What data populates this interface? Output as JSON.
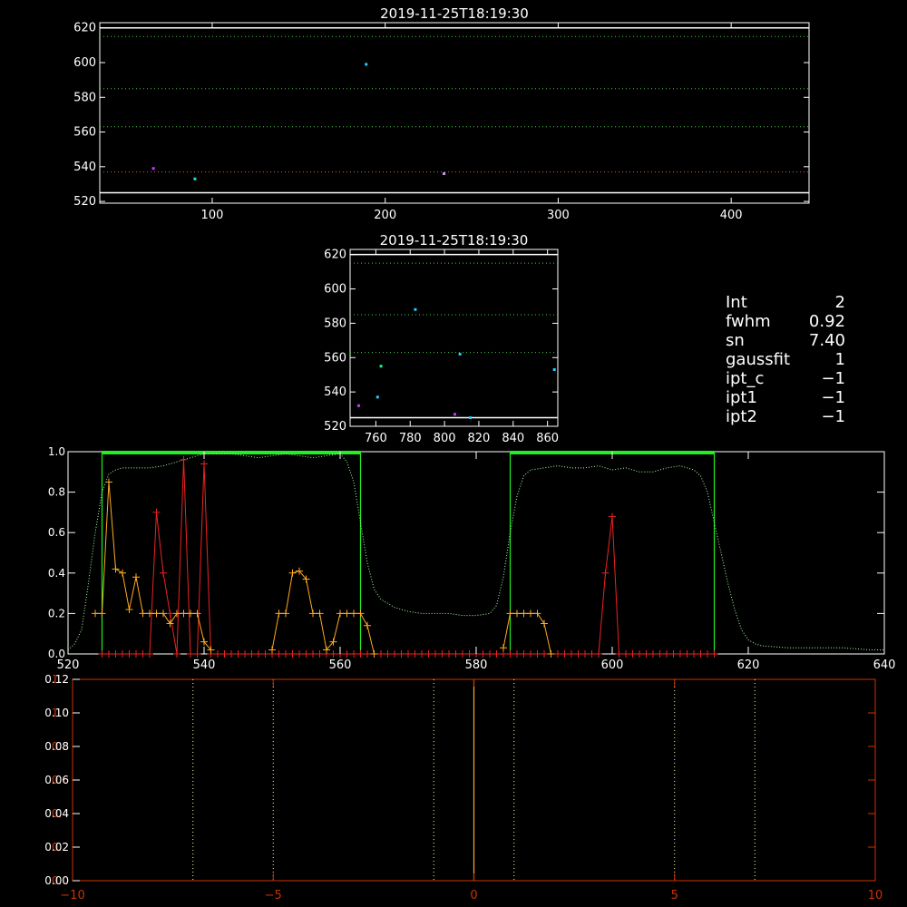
{
  "chart_data": [
    {
      "id": "top",
      "type": "scatter",
      "title": "2019-11-25T18:19:30",
      "xlim": [
        35,
        445
      ],
      "ylim": [
        519,
        623
      ],
      "xticks": [
        100,
        200,
        300,
        400
      ],
      "yticks": [
        520,
        540,
        560,
        580,
        600,
        620
      ],
      "hlines": [
        {
          "y": 620,
          "color": "#ffffff",
          "style": "solid"
        },
        {
          "y": 615,
          "color": "#44cc44",
          "style": "dotted"
        },
        {
          "y": 585,
          "color": "#44cc44",
          "style": "dotted"
        },
        {
          "y": 563,
          "color": "#44cc44",
          "style": "dotted"
        },
        {
          "y": 537,
          "color": "#cc6633",
          "style": "dotted"
        },
        {
          "y": 525,
          "color": "#ffffff",
          "style": "solid"
        }
      ],
      "points": [
        {
          "x": 66,
          "y": 539,
          "color": "#cc33ff"
        },
        {
          "x": 90,
          "y": 533,
          "color": "#22ddee"
        },
        {
          "x": 189,
          "y": 599,
          "color": "#22ccff"
        },
        {
          "x": 234,
          "y": 536,
          "color": "#cc99ff"
        }
      ]
    },
    {
      "id": "mid",
      "type": "scatter",
      "title": "2019-11-25T18:19:30",
      "xlim": [
        745,
        866
      ],
      "ylim": [
        520,
        623
      ],
      "xticks": [
        760,
        780,
        800,
        820,
        840,
        860
      ],
      "yticks": [
        520,
        540,
        560,
        580,
        600,
        620
      ],
      "hlines": [
        {
          "y": 620,
          "color": "#ffffff",
          "style": "solid"
        },
        {
          "y": 615,
          "color": "#44cc44",
          "style": "dotted"
        },
        {
          "y": 585,
          "color": "#44cc44",
          "style": "dotted"
        },
        {
          "y": 563,
          "color": "#44cc44",
          "style": "dotted"
        },
        {
          "y": 525,
          "color": "#ffffff",
          "style": "solid"
        }
      ],
      "points": [
        {
          "x": 750,
          "y": 532,
          "color": "#cc33ff"
        },
        {
          "x": 761,
          "y": 537,
          "color": "#22ccff"
        },
        {
          "x": 763,
          "y": 555,
          "color": "#22ee99"
        },
        {
          "x": 783,
          "y": 588,
          "color": "#22ccff"
        },
        {
          "x": 806,
          "y": 527,
          "color": "#cc33ff"
        },
        {
          "x": 809,
          "y": 562,
          "color": "#22ccff"
        },
        {
          "x": 815,
          "y": 525,
          "color": "#22ccff"
        },
        {
          "x": 864,
          "y": 553,
          "color": "#22ccff"
        }
      ]
    },
    {
      "id": "spectrum",
      "type": "line",
      "xlim": [
        520,
        640
      ],
      "ylim": [
        0,
        1.0
      ],
      "xticks": [
        520,
        540,
        560,
        580,
        600,
        620,
        640
      ],
      "yticks": [
        0.0,
        0.2,
        0.4,
        0.6,
        0.8,
        1.0
      ],
      "ytick_labels": [
        "0.0",
        "0.2",
        "0.4",
        "0.6",
        "0.8",
        "1.0"
      ],
      "bands": [
        [
          525,
          563
        ],
        [
          585,
          615
        ]
      ],
      "transmission": {
        "x": [
          520,
          521,
          522,
          523,
          524,
          525,
          526,
          527,
          528,
          529,
          530,
          532,
          534,
          536,
          538,
          540,
          542,
          544,
          546,
          548,
          550,
          552,
          554,
          556,
          558,
          560,
          561,
          562,
          563,
          564,
          565,
          566,
          568,
          570,
          572,
          574,
          576,
          578,
          580,
          582,
          583,
          584,
          585,
          586,
          587,
          588,
          590,
          592,
          594,
          596,
          598,
          600,
          602,
          604,
          606,
          608,
          610,
          612,
          613,
          614,
          615,
          616,
          617,
          618,
          619,
          620,
          621,
          622,
          624,
          626,
          628,
          630,
          632,
          634,
          636,
          638,
          640
        ],
        "y": [
          0.02,
          0.05,
          0.12,
          0.35,
          0.6,
          0.8,
          0.89,
          0.91,
          0.92,
          0.92,
          0.92,
          0.92,
          0.93,
          0.95,
          0.97,
          0.99,
          0.99,
          0.99,
          0.98,
          0.97,
          0.98,
          0.99,
          0.98,
          0.97,
          0.98,
          0.99,
          0.95,
          0.85,
          0.65,
          0.45,
          0.32,
          0.27,
          0.23,
          0.21,
          0.2,
          0.2,
          0.2,
          0.19,
          0.19,
          0.2,
          0.24,
          0.38,
          0.6,
          0.78,
          0.88,
          0.91,
          0.92,
          0.93,
          0.92,
          0.92,
          0.93,
          0.91,
          0.92,
          0.9,
          0.9,
          0.92,
          0.93,
          0.91,
          0.88,
          0.8,
          0.65,
          0.5,
          0.35,
          0.22,
          0.12,
          0.07,
          0.05,
          0.04,
          0.035,
          0.03,
          0.03,
          0.03,
          0.03,
          0.03,
          0.025,
          0.02,
          0.02
        ]
      },
      "orange_series": {
        "x": [
          524,
          525,
          526,
          527,
          528,
          529,
          530,
          531,
          532,
          533,
          534,
          535,
          536,
          537,
          538,
          539,
          540,
          541,
          550,
          551,
          552,
          553,
          554,
          555,
          556,
          557,
          558,
          559,
          560,
          561,
          562,
          563,
          564,
          565,
          584,
          585,
          586,
          587,
          588,
          589,
          590,
          591
        ],
        "y": [
          0.2,
          0.2,
          0.85,
          0.42,
          0.4,
          0.22,
          0.38,
          0.2,
          0.2,
          0.2,
          0.2,
          0.15,
          0.2,
          0.2,
          0.2,
          0.2,
          0.06,
          0.02,
          0.02,
          0.2,
          0.2,
          0.4,
          0.41,
          0.37,
          0.2,
          0.2,
          0.02,
          0.06,
          0.2,
          0.2,
          0.2,
          0.2,
          0.14,
          0.0,
          0.03,
          0.2,
          0.2,
          0.2,
          0.2,
          0.2,
          0.15,
          0.0
        ]
      },
      "red_series": {
        "x": [
          525,
          526,
          527,
          528,
          529,
          530,
          531,
          532,
          533,
          534,
          535,
          536,
          537,
          538,
          539,
          540,
          541,
          542,
          543,
          544,
          545,
          546,
          547,
          548,
          549,
          550,
          551,
          552,
          553,
          554,
          555,
          556,
          557,
          558,
          559,
          560,
          561,
          562,
          563,
          564,
          565,
          566,
          567,
          568,
          569,
          570,
          571,
          572,
          573,
          574,
          575,
          576,
          577,
          578,
          579,
          580,
          581,
          582,
          583,
          584,
          585,
          586,
          587,
          588,
          589,
          590,
          591,
          592,
          593,
          594,
          595,
          596,
          597,
          598,
          599,
          600,
          601,
          602,
          603,
          604,
          605,
          606,
          607,
          608,
          609,
          610,
          611,
          612,
          613,
          614,
          615
        ],
        "y": [
          0,
          0,
          0,
          0,
          0,
          0,
          0,
          0,
          0.7,
          0.4,
          0.2,
          0,
          0.96,
          0,
          0,
          0.94,
          0,
          0,
          0,
          0,
          0,
          0,
          0,
          0,
          0,
          0,
          0,
          0,
          0,
          0,
          0,
          0,
          0,
          0,
          0,
          0,
          0,
          0,
          0,
          0,
          0,
          0,
          0,
          0,
          0,
          0,
          0,
          0,
          0,
          0,
          0,
          0,
          0,
          0,
          0,
          0,
          0,
          0,
          0,
          0,
          0,
          0,
          0,
          0,
          0,
          0,
          0,
          0,
          0,
          0,
          0,
          0,
          0,
          0,
          0.4,
          0.68,
          0,
          0,
          0,
          0,
          0,
          0,
          0,
          0,
          0,
          0,
          0,
          0,
          0,
          0,
          0
        ]
      }
    },
    {
      "id": "bottom",
      "type": "line",
      "xlim": [
        -10,
        10
      ],
      "xticks": [
        -10,
        -5,
        0,
        5,
        10
      ],
      "left_ylim": [
        0,
        0.12
      ],
      "left_yticks": [
        0.0,
        0.02,
        0.04,
        0.06,
        0.08,
        0.1,
        0.12
      ],
      "left_ytick_labels": [
        "0.00",
        "0.02",
        "0.04",
        "0.06",
        "0.08",
        "0.10",
        "0.12"
      ],
      "right_ylim": [
        0,
        1.2
      ],
      "right_yticks": [
        0.0,
        0.2,
        0.4,
        0.6,
        0.8,
        1.0,
        1.2
      ],
      "right_ytick_labels": [
        "0.0",
        "0.2",
        "0.4",
        "0.6",
        "0.8",
        "1.0",
        "1.2"
      ],
      "vlines_dotted": [
        -7,
        -5,
        -1,
        1,
        5,
        7
      ],
      "vline_solid": 0
    }
  ],
  "info": {
    "rows": [
      {
        "label": "Int",
        "value": "2"
      },
      {
        "label": "fwhm",
        "value": "0.92"
      },
      {
        "label": "sn",
        "value": "7.40"
      },
      {
        "label": "gaussfit",
        "value": "1"
      },
      {
        "label": "ipt_c",
        "value": "−1"
      },
      {
        "label": "ipt1",
        "value": "−1"
      },
      {
        "label": "ipt2",
        "value": "−1"
      }
    ]
  },
  "colors": {
    "axis": "#ffffff",
    "bottom_axis": "#cc3300",
    "green": "#22ee22",
    "orange": "#ffaa22",
    "red": "#ee2222",
    "transmission": "#aaffaa",
    "pale_yellow": "#ffffaa"
  }
}
